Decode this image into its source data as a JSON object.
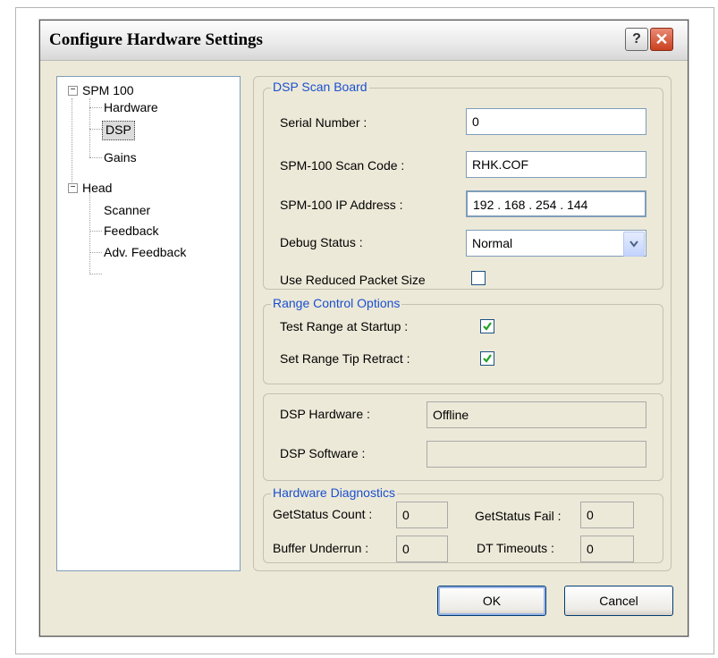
{
  "window": {
    "title": "Configure Hardware Settings"
  },
  "titlebar": {
    "help_label": "?",
    "close_label": "✕"
  },
  "tree": [
    {
      "label": "SPM 100",
      "expander": "−"
    },
    {
      "label": "Hardware"
    },
    {
      "label": "DSP",
      "selected": true
    },
    {
      "label": "Gains"
    },
    {
      "label": "Head",
      "expander": "−"
    },
    {
      "label": "Scanner"
    },
    {
      "label": "Feedback"
    },
    {
      "label": "Adv. Feedback"
    }
  ],
  "dsp_scan_board": {
    "title": "DSP Scan Board",
    "serial_label": "Serial Number :",
    "serial_value": "0",
    "scan_code_label": "SPM-100 Scan Code :",
    "scan_code_value": "RHK.COF",
    "ip_label": "SPM-100 IP Address :",
    "ip_value": " 192 . 168 . 254 . 144",
    "debug_label": "Debug Status :",
    "debug_value": "Normal",
    "reduced_packet_label": "Use Reduced Packet Size",
    "reduced_packet_checked": false
  },
  "range_control": {
    "title": "Range Control Options",
    "test_range_label": "Test Range at Startup :",
    "test_range_checked": true,
    "tip_retract_label": "Set Range Tip Retract :",
    "tip_retract_checked": true
  },
  "dsp_status": {
    "hardware_label": "DSP Hardware :",
    "hardware_value": "Offline",
    "software_label": "DSP Software :",
    "software_value": ""
  },
  "diagnostics": {
    "title": "Hardware Diagnostics",
    "getstatus_count_label": "GetStatus Count :",
    "getstatus_count_value": "0",
    "getstatus_fail_label": "GetStatus Fail :",
    "getstatus_fail_value": "0",
    "buffer_underrun_label": "Buffer Underrun :",
    "buffer_underrun_value": "0",
    "dt_timeouts_label": "DT Timeouts :",
    "dt_timeouts_value": "0"
  },
  "buttons": {
    "ok": "OK",
    "cancel": "Cancel"
  },
  "colors": {
    "group_title": "#1a4fd0",
    "dialog_bg": "#ece9d8",
    "check": "#21a121"
  }
}
